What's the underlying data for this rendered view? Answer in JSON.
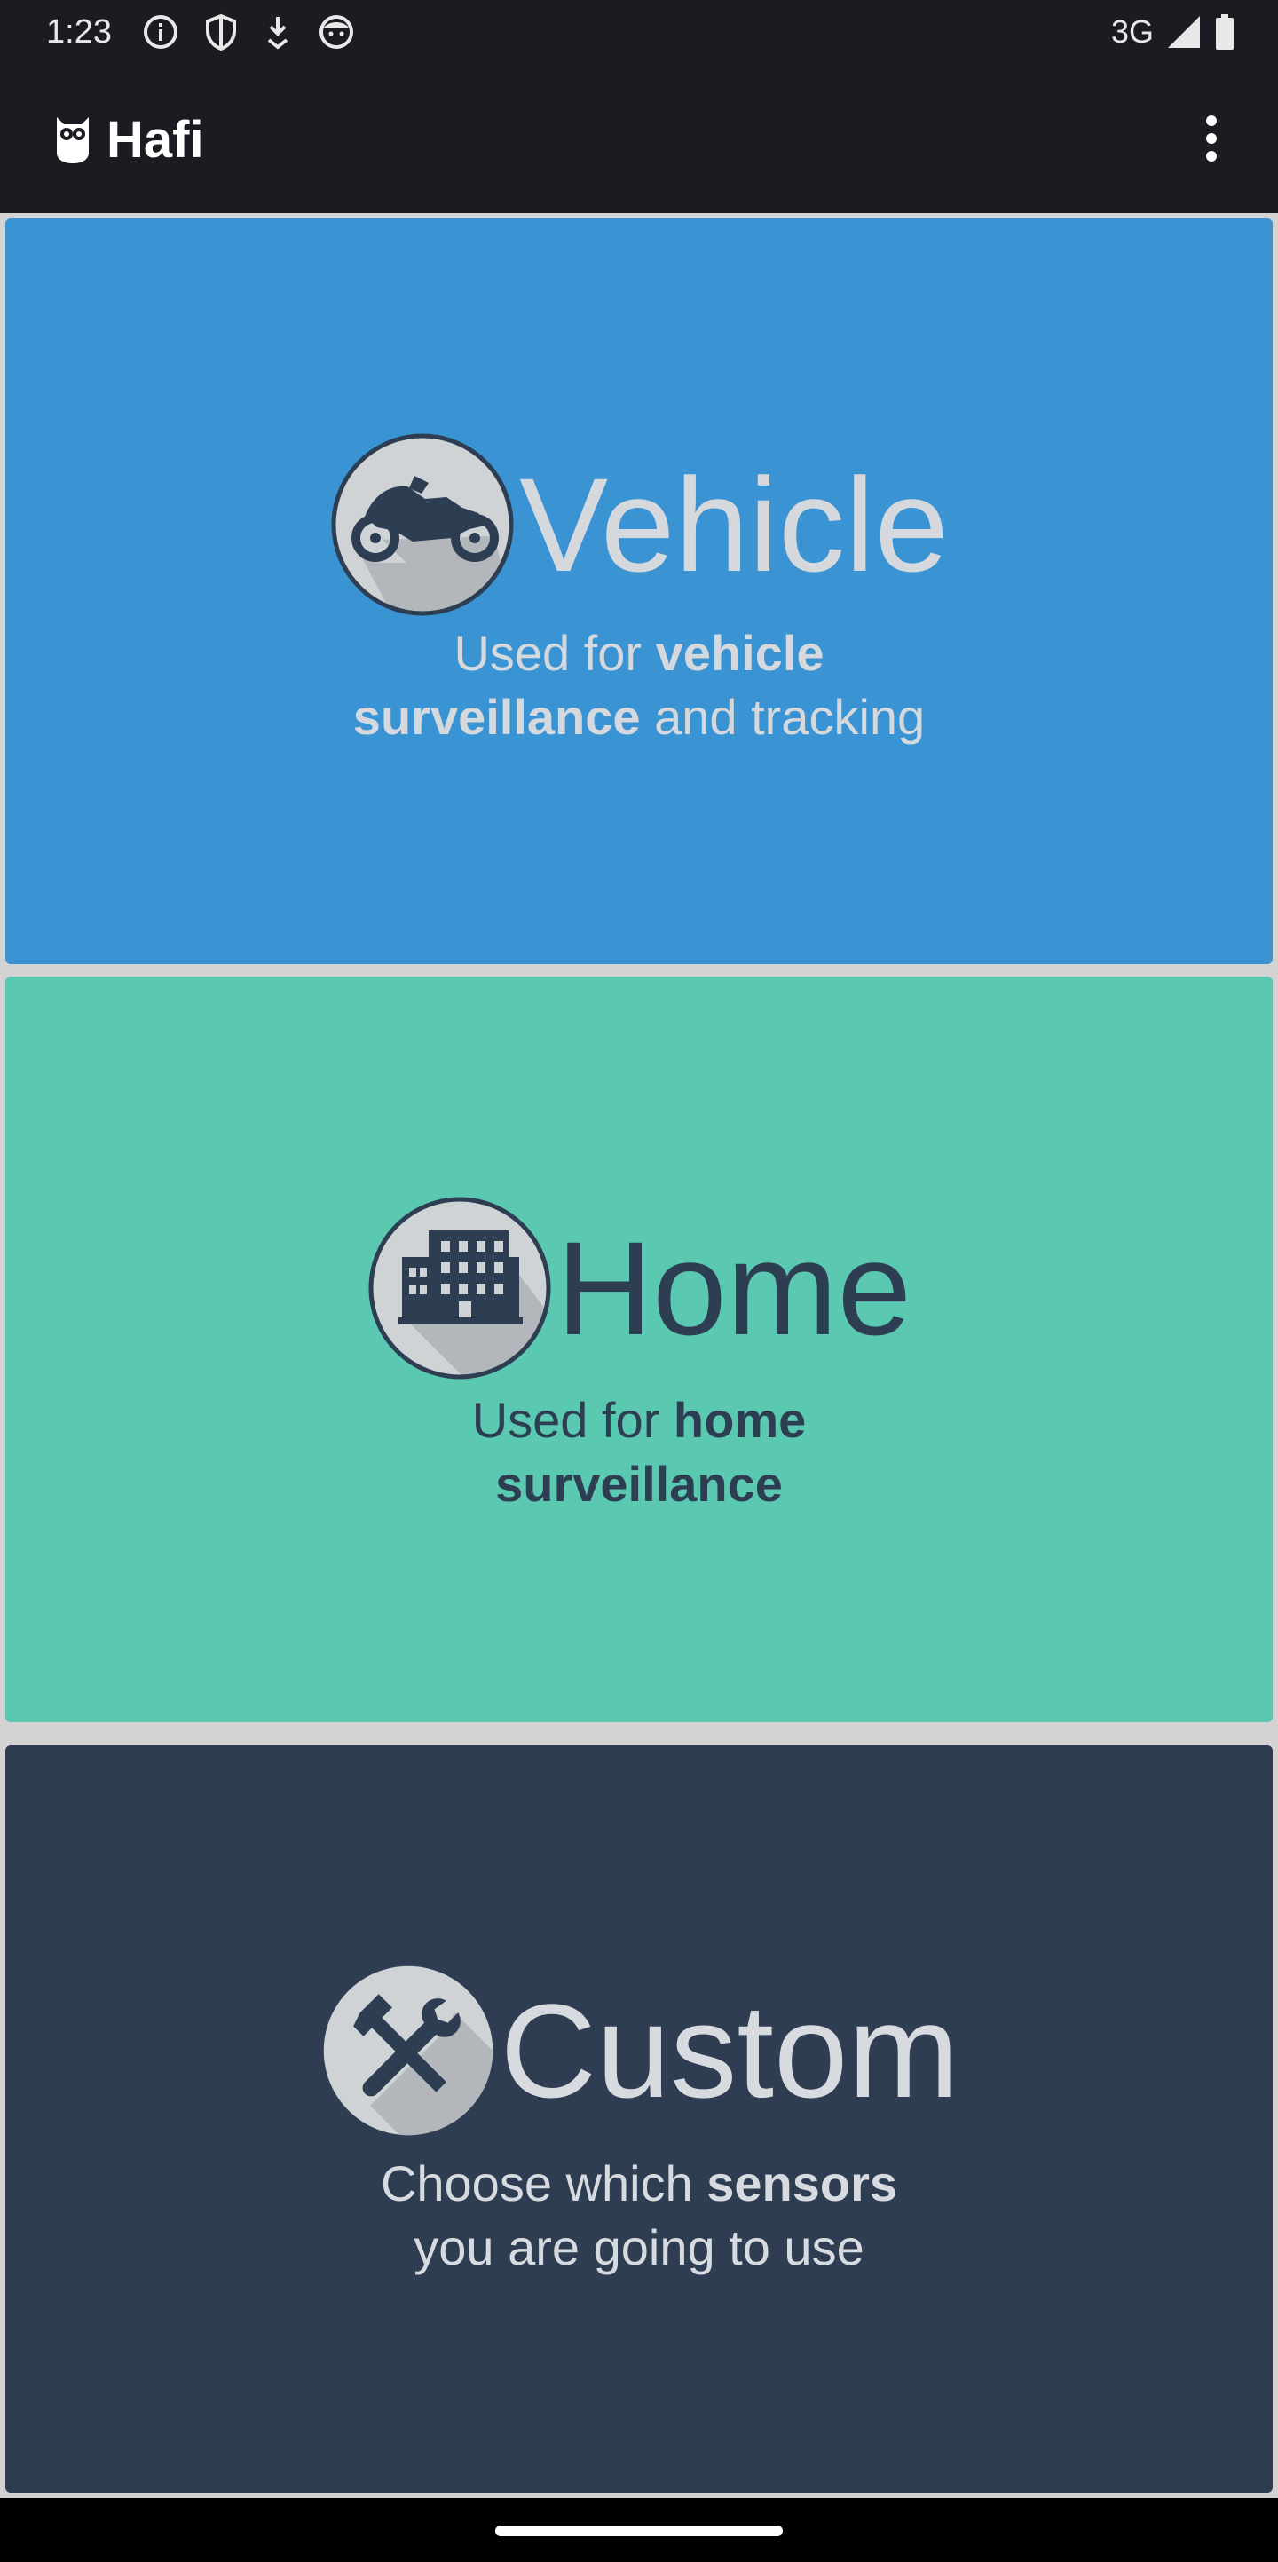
{
  "status_bar": {
    "time": "1:23",
    "network": "3G",
    "left_icons": [
      "info-icon",
      "shield-icon",
      "download-icon",
      "face-icon"
    ],
    "right_icons": [
      "signal-icon",
      "battery-icon"
    ]
  },
  "app_bar": {
    "title": "Hafi",
    "logo_icon": "owl-icon",
    "menu_icon": "more-vert-icon"
  },
  "cards": [
    {
      "title": "Vehicle",
      "desc_pre": "Used for ",
      "desc_bold1": "vehicle",
      "desc_bold2": "surveillance",
      "desc_post": " and tracking",
      "icon": "motorcycle-icon",
      "background": "#3a94d3",
      "text_color": "#d5d9dd"
    },
    {
      "title": "Home",
      "desc_pre": "Used for ",
      "desc_bold1": "home",
      "desc_bold2": "surveillance",
      "desc_post": "",
      "icon": "building-icon",
      "background": "#5bc8b2",
      "text_color": "#2d3e52"
    },
    {
      "title": "Custom",
      "desc_pre": "Choose which ",
      "desc_bold1": "sensors",
      "desc_line2": "you are going to use",
      "icon": "tools-icon",
      "background": "#2e3d51",
      "text_color": "#d7dade"
    }
  ]
}
